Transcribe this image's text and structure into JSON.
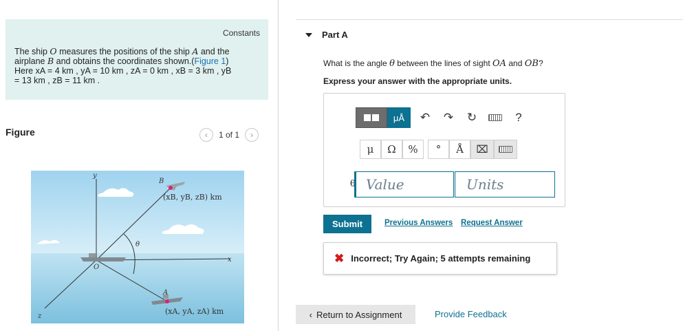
{
  "problem": {
    "constants": "Constants",
    "line1_a": "The ship ",
    "O": "O",
    "line1_b": " measures the positions of the ship ",
    "A": "A",
    "line1_c": " and the",
    "line2_a": "airplane ",
    "B": "B",
    "line2_b": " and obtains the coordinates shown.(",
    "figure_link": "Figure 1",
    "line2_c": ")",
    "line3": "Here x",
    "values_line": "Here xA = 4 km , yA = 10 km , zA = 0 km , xB = 3 km , yB",
    "values_line2": "= 13 km , zB = 11 km ."
  },
  "figure_panel": {
    "title": "Figure",
    "pager": "1 of 1",
    "prev_icon": "chevron-left-icon",
    "next_icon": "chevron-right-icon",
    "labels": {
      "y": "y",
      "x": "x",
      "z": "z",
      "O": "O",
      "A": "A",
      "B": "B",
      "theta": "θ",
      "B_coords": "(xB, yB, zB) km",
      "A_coords": "(xA, yA, zA) km"
    }
  },
  "part": {
    "title": "Part A",
    "question_a": "What is the angle ",
    "theta": "θ",
    "question_b": " between the lines of sight ",
    "OA": "OA",
    "question_c": " and ",
    "OB": "OB",
    "question_d": "?",
    "instruction": "Express your answer with the appropriate units."
  },
  "toolbar": {
    "mu_A": "μÅ",
    "help": "?",
    "symbols": [
      "μ",
      "Ω",
      "%",
      "°",
      "Å"
    ]
  },
  "answer": {
    "theta_label": "θ =",
    "value_placeholder": "Value",
    "units_placeholder": "Units"
  },
  "actions": {
    "submit": "Submit",
    "previous_answers": "Previous Answers",
    "request_answer": "Request Answer",
    "return": "Return to Assignment",
    "provide_feedback": "Provide Feedback"
  },
  "feedback": {
    "message": "Incorrect; Try Again; 5 attempts remaining"
  },
  "colors": {
    "accent": "#0d7191",
    "problem_bg": "#e0f1ef",
    "error": "#d11a1a"
  }
}
